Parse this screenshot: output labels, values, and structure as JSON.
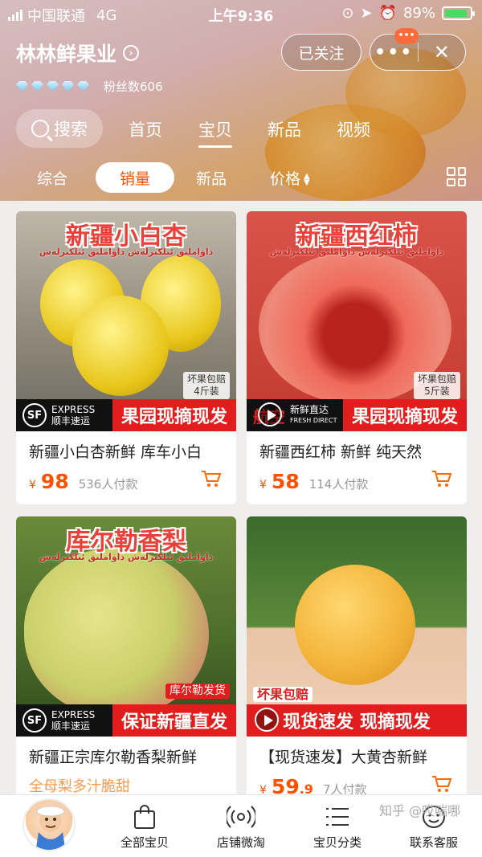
{
  "status": {
    "carrier": "中国联通",
    "network": "4G",
    "time": "上午9:36",
    "battery": "89%"
  },
  "shop": {
    "name": "林林鲜果业",
    "follow_label": "已关注",
    "more_label": "•••",
    "close_label": "✕",
    "badge": "•••",
    "fans": "粉丝数606",
    "diamonds": 5
  },
  "nav": {
    "search_label": "搜索",
    "tabs": [
      "首页",
      "宝贝",
      "新品",
      "视频"
    ],
    "active_tab": "宝贝"
  },
  "sort": {
    "items": [
      "综合",
      "销量",
      "新品",
      "价格"
    ],
    "active": "销量"
  },
  "products": [
    {
      "banner": "新疆小白杏",
      "uyghur": "داۋاملىق ئىلكىرلەش داۋاملىق ئىلكىرلەش",
      "tag1": "坏果包赔",
      "tag2": "4斤装",
      "logo_main": "EXPRESS",
      "logo_sub": "顺丰速运",
      "slogan": "果园现摘现发",
      "title": "新疆小白杏新鲜 库车小白",
      "yen": "¥",
      "price": "98",
      "payers": "536人付款"
    },
    {
      "banner": "新疆西红柿",
      "uyghur": "داۋاملىق ئىلكىرلەش داۋاملىق ئىلكىرلەش",
      "tag1": "坏果包赔",
      "tag2": "5斤装",
      "logo_main": "新鲜直达",
      "logo_sub": "FRESH DIRECT",
      "logo_prefix": "航空",
      "slogan": "果园现摘现发",
      "title": "新疆西红柿 新鲜 纯天然",
      "yen": "¥",
      "price": "58",
      "payers": "114人付款"
    },
    {
      "banner": "库尔勒香梨",
      "uyghur": "داۋاملىق ئىلكىرلەش داۋاملىق ئىلكىرلەش",
      "tag1": "库尔勒发货",
      "logo_main": "EXPRESS",
      "logo_sub": "顺丰速运",
      "slogan": "保证新疆直发",
      "title": "新疆正宗库尔勒香梨新鲜",
      "subtitle": "全母梨多汁脆甜",
      "yen": "¥",
      "price": "",
      "payers": ""
    },
    {
      "banner": "",
      "tag1": "坏果包赔",
      "slogan": "现货速发 现摘现发",
      "title": "【现货速发】大黄杏新鲜",
      "yen": "¥",
      "price": "59",
      "price_decimal": ".9",
      "payers": "7人付款"
    }
  ],
  "tabbar": {
    "items": [
      "全部宝贝",
      "店铺微淘",
      "宝贝分类",
      "联系客服"
    ],
    "watermark": "知乎 @哎喘哪"
  }
}
